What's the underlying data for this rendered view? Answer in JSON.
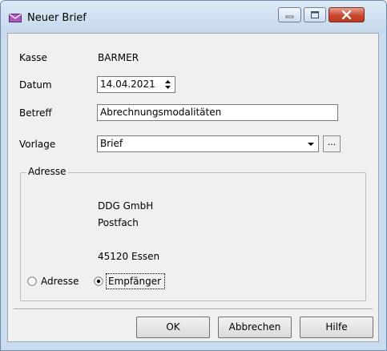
{
  "window": {
    "title": "Neuer Brief",
    "app_icon": "envelope-icon",
    "controls": [
      "minimize-icon",
      "maximize-icon",
      "close-icon"
    ]
  },
  "form": {
    "kasse": {
      "label": "Kasse",
      "value": "BARMER"
    },
    "datum": {
      "label": "Datum",
      "value": "14.04.2021"
    },
    "betreff": {
      "label": "Betreff",
      "value": "Abrechnungsmodalitäten"
    },
    "vorlage": {
      "label": "Vorlage",
      "value": "Brief",
      "browse_label": "..."
    }
  },
  "adresse": {
    "group_title": "Adresse",
    "lines": [
      "DDG GmbH",
      "Postfach",
      "",
      "45120  Essen"
    ],
    "radio_options": [
      {
        "label": "Adresse",
        "selected": false
      },
      {
        "label": "Empfänger",
        "selected": true
      }
    ]
  },
  "buttons": {
    "ok": "OK",
    "cancel": "Abbrechen",
    "help": "Hilfe"
  }
}
